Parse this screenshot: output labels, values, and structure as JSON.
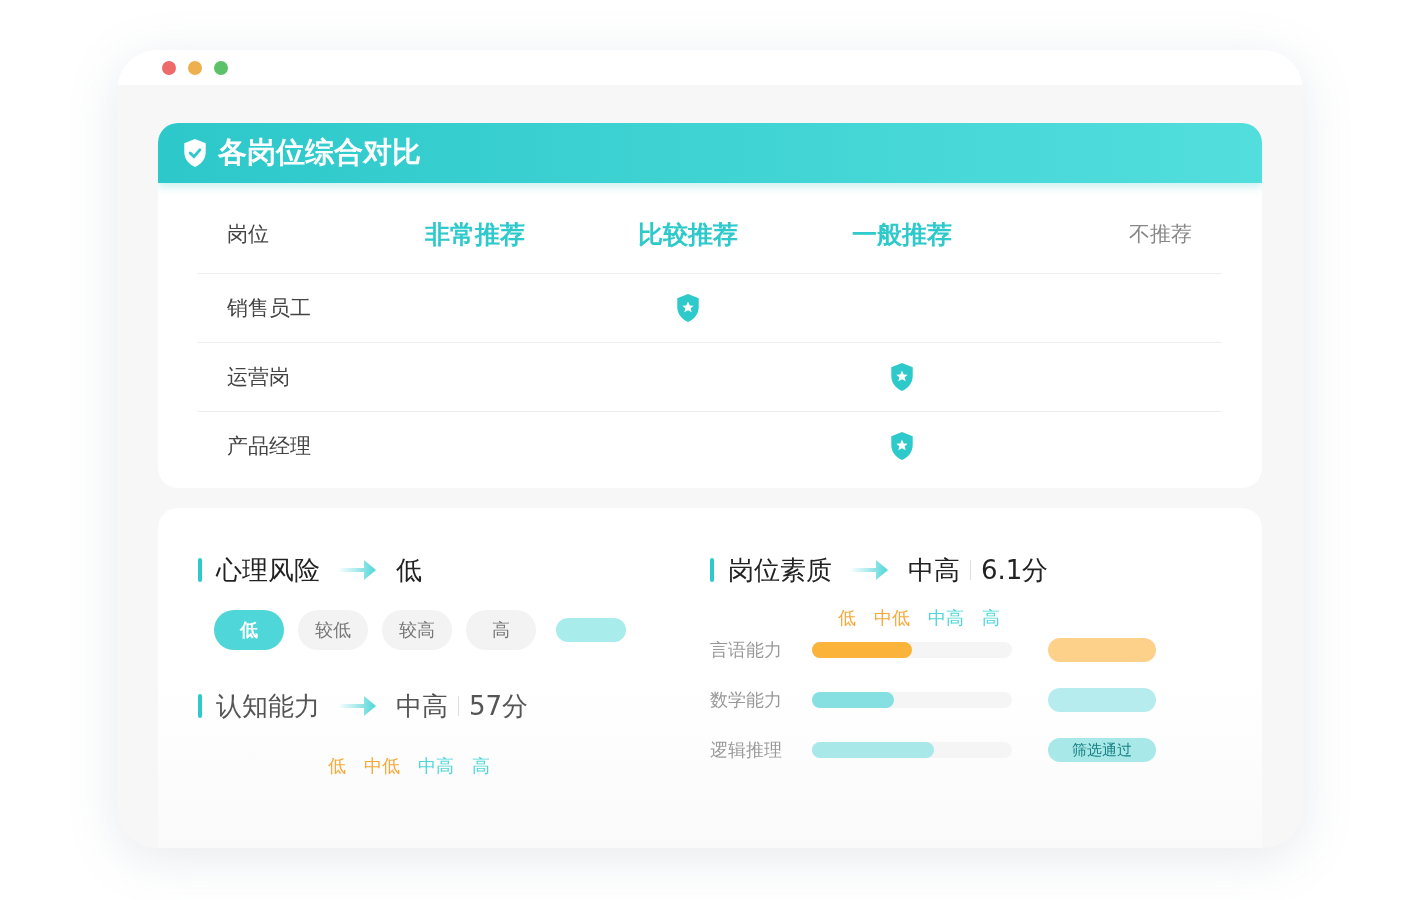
{
  "window": {
    "controls": [
      {
        "color": "#ee6a6a"
      },
      {
        "color": "#eeb04e"
      },
      {
        "color": "#5cc26a"
      }
    ]
  },
  "comparison": {
    "title": "各岗位综合对比",
    "columns": [
      {
        "label": "岗位",
        "kind": "name"
      },
      {
        "label": "非常推荐",
        "kind": "positive"
      },
      {
        "label": "比较推荐",
        "kind": "positive"
      },
      {
        "label": "一般推荐",
        "kind": "positive"
      },
      {
        "label": "不推荐",
        "kind": "negative"
      }
    ],
    "rows": [
      {
        "name": "销售员工",
        "marks": [
          false,
          true,
          false,
          false
        ]
      },
      {
        "name": "运营岗",
        "marks": [
          false,
          false,
          true,
          false
        ]
      },
      {
        "name": "产品经理",
        "marks": [
          false,
          false,
          true,
          false
        ]
      }
    ]
  },
  "risk": {
    "title": "心理风险",
    "result": "低",
    "levels": [
      {
        "label": "低",
        "selected": true
      },
      {
        "label": "较低",
        "selected": false
      },
      {
        "label": "较高",
        "selected": false
      },
      {
        "label": "高",
        "selected": false
      }
    ]
  },
  "cognitive": {
    "title": "认知能力",
    "result": "中高",
    "score": "57分",
    "scale": [
      {
        "label": "低",
        "color": "#f7a838"
      },
      {
        "label": "中低",
        "color": "#f7a838"
      },
      {
        "label": "中高",
        "color": "#4fd6d8"
      },
      {
        "label": "高",
        "color": "#4fd6d8"
      }
    ]
  },
  "quality": {
    "title": "岗位素质",
    "result": "中高",
    "score": "6.1分",
    "scale": [
      {
        "label": "低",
        "color": "#f7a838"
      },
      {
        "label": "中低",
        "color": "#f7a838"
      },
      {
        "label": "中高",
        "color": "#4fd6d8"
      },
      {
        "label": "高",
        "color": "#4fd6d8"
      }
    ],
    "rows": [
      {
        "name": "言语能力",
        "level": 0.5,
        "color": "#fbb33a"
      },
      {
        "name": "数学能力",
        "level": 0.41,
        "color": "#86e0e2"
      },
      {
        "name": "逻辑推理",
        "level": 0.61,
        "color": "#a8e8e9",
        "badge": "筛选通过"
      }
    ]
  }
}
